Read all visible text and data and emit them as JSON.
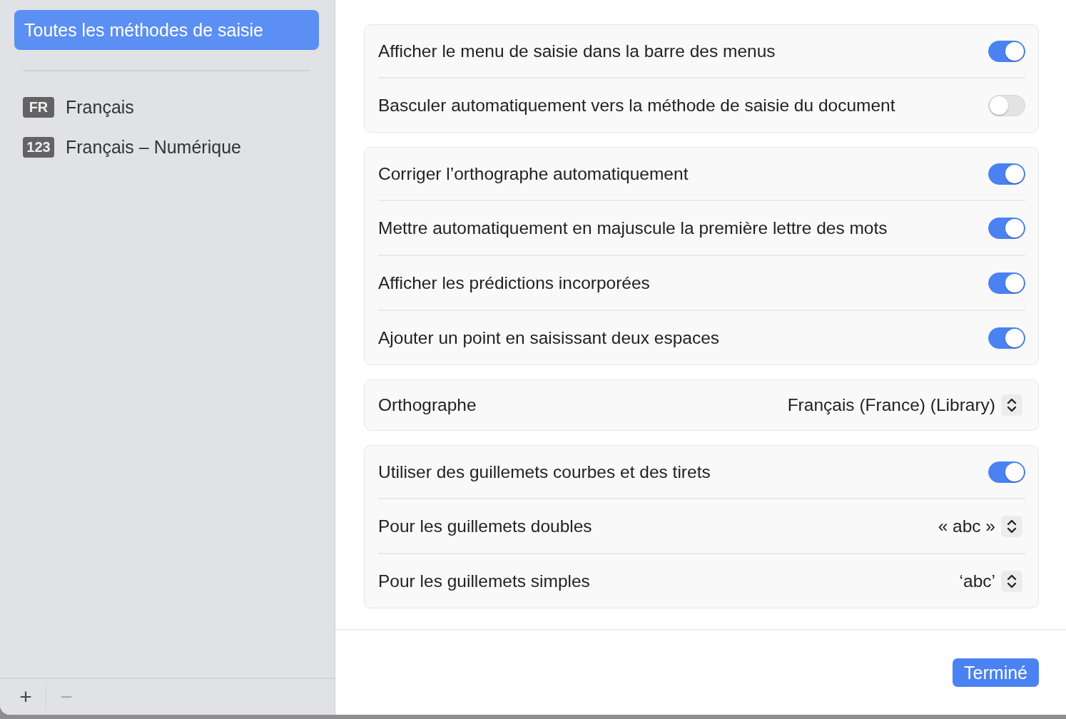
{
  "sidebar": {
    "items": [
      {
        "label": "Toutes les méthodes de saisie",
        "selected": true
      },
      {
        "badge": "FR",
        "label": "Français",
        "selected": false
      },
      {
        "badge": "123",
        "label": "Français – Numérique",
        "selected": false
      }
    ],
    "footer_buttons": [
      {
        "label": "+",
        "disabled": false
      },
      {
        "label": "−",
        "disabled": true
      }
    ]
  },
  "groups": [
    {
      "rows": [
        {
          "kind": "toggle",
          "label": "Afficher le menu de saisie dans la barre des menus",
          "on": true
        },
        {
          "kind": "toggle",
          "label": "Basculer automatiquement vers la méthode de saisie du document",
          "on": false
        }
      ]
    },
    {
      "rows": [
        {
          "kind": "toggle",
          "label": "Corriger l’orthographe automatiquement",
          "on": true
        },
        {
          "kind": "toggle",
          "label": "Mettre automatiquement en majuscule la première lettre des mots",
          "on": true
        },
        {
          "kind": "toggle",
          "label": "Afficher les prédictions incorporées",
          "on": true
        },
        {
          "kind": "toggle",
          "label": "Ajouter un point en saisissant deux espaces",
          "on": true
        }
      ]
    },
    {
      "rows": [
        {
          "kind": "popup",
          "label": "Orthographe",
          "value": "Français (France) (Library)"
        }
      ]
    },
    {
      "rows": [
        {
          "kind": "toggle",
          "label": "Utiliser des guillemets courbes et des tirets",
          "on": true
        },
        {
          "kind": "popup",
          "label": "Pour les guillemets doubles",
          "value": "« abc »"
        },
        {
          "kind": "popup",
          "label": "Pour les guillemets simples",
          "value": "‘abc’"
        }
      ]
    }
  ],
  "done_button": {
    "label": "Terminé"
  }
}
